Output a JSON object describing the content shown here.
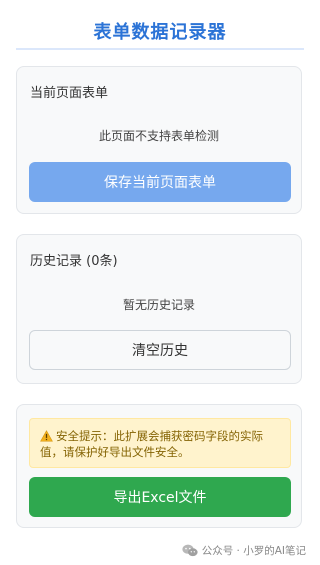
{
  "header": {
    "title": "表单数据记录器"
  },
  "current_form": {
    "title": "当前页面表单",
    "message": "此页面不支持表单检测",
    "save_button": "保存当前页面表单"
  },
  "history": {
    "title": "历史记录 (0条)",
    "message": "暂无历史记录",
    "clear_button": "清空历史"
  },
  "export": {
    "warning": "安全提示：此扩展会捕获密码字段的实际值，请保护好导出文件安全。",
    "export_button": "导出Excel文件"
  },
  "footer": {
    "watermark": "公众号 · 小罗的AI笔记"
  },
  "colors": {
    "accent": "#2b73d6",
    "save_button": "#76a8ee",
    "export_button": "#2fa84f",
    "warning_bg": "#fff3cd"
  },
  "icons": {
    "warning": "warning-icon",
    "wechat": "wechat-icon"
  }
}
